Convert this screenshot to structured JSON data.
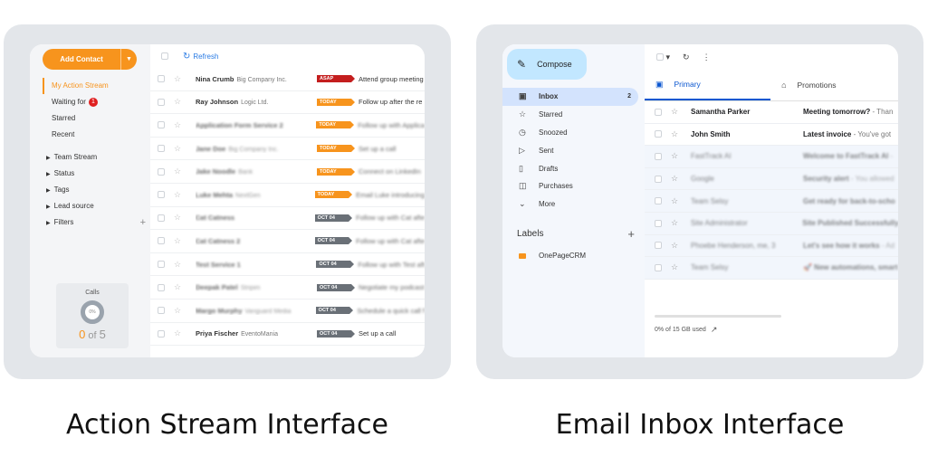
{
  "captions": {
    "left": "Action Stream Interface",
    "right": "Email Inbox Interface"
  },
  "crm": {
    "add_contact": "Add Contact",
    "refresh": "Refresh",
    "nav": [
      {
        "label": "My Action Stream",
        "active": true
      },
      {
        "label": "Waiting for",
        "badge": "1"
      },
      {
        "label": "Starred"
      },
      {
        "label": "Recent"
      }
    ],
    "groups": [
      "Team Stream",
      "Status",
      "Tags",
      "Lead source",
      "Filters"
    ],
    "calls": {
      "title": "Calls",
      "percent": "0%",
      "done": "0",
      "of": "of",
      "total": "5"
    },
    "rows": [
      {
        "name": "Nina Crumb",
        "company": "Big Company Inc.",
        "tag": "ASAP",
        "tag_type": "asap",
        "task": "Attend group meeting",
        "blur": false
      },
      {
        "name": "Ray Johnson",
        "company": "Logic Ltd.",
        "tag": "TODAY",
        "tag_type": "today",
        "task": "Follow up after the re",
        "blur": false
      },
      {
        "name": "Application Form Service 2",
        "company": "",
        "tag": "TODAY",
        "tag_type": "today",
        "task": "Follow up with Applica",
        "blur": true
      },
      {
        "name": "Jane Doe",
        "company": "Big Company Inc.",
        "tag": "TODAY",
        "tag_type": "today",
        "task": "Set up a call",
        "blur": true
      },
      {
        "name": "Jake Noodle",
        "company": "Bank",
        "tag": "TODAY",
        "tag_type": "today",
        "task": "Connect on LinkedIn",
        "blur": true
      },
      {
        "name": "Luke Mehta",
        "company": "NextGen",
        "tag": "TODAY",
        "tag_type": "today",
        "task": "Email Luke introducing",
        "blur": true
      },
      {
        "name": "Cat Catness",
        "company": "",
        "tag": "OCT 04",
        "tag_type": "oct",
        "task": "Follow up with Cat afte",
        "blur": true
      },
      {
        "name": "Cat Catness 2",
        "company": "",
        "tag": "OCT 04",
        "tag_type": "oct",
        "task": "Follow up with Cat afte",
        "blur": true
      },
      {
        "name": "Test Service 1",
        "company": "",
        "tag": "OCT 04",
        "tag_type": "oct",
        "task": "Follow up with Test aft",
        "blur": true
      },
      {
        "name": "Deepak Patel",
        "company": "Stripim",
        "tag": "OCT 04",
        "tag_type": "oct",
        "task": "Negotiate my podcast",
        "blur": true
      },
      {
        "name": "Margo Murphy",
        "company": "Vanguard Media",
        "tag": "OCT 04",
        "tag_type": "oct",
        "task": "Schedule a quick call f",
        "blur": true
      },
      {
        "name": "Priya Fischer",
        "company": "EventoMania",
        "tag": "OCT 04",
        "tag_type": "oct",
        "task": "Set up a call",
        "blur": false
      }
    ]
  },
  "mail": {
    "compose": "Compose",
    "folders": [
      {
        "label": "Inbox",
        "icon": "inbox-icon",
        "glyph": "▣",
        "count": "2",
        "active": true
      },
      {
        "label": "Starred",
        "icon": "star-icon",
        "glyph": "☆"
      },
      {
        "label": "Snoozed",
        "icon": "clock-icon",
        "glyph": "◷"
      },
      {
        "label": "Sent",
        "icon": "send-icon",
        "glyph": "▷"
      },
      {
        "label": "Drafts",
        "icon": "draft-icon",
        "glyph": "▯"
      },
      {
        "label": "Purchases",
        "icon": "bag-icon",
        "glyph": "◫"
      },
      {
        "label": "More",
        "icon": "chevron-down-icon",
        "glyph": "⌄"
      }
    ],
    "labels_title": "Labels",
    "labels": [
      {
        "label": "OnePageCRM",
        "color": "#f7941d"
      }
    ],
    "tabs": [
      {
        "label": "Primary",
        "active": true,
        "glyph": "▣"
      },
      {
        "label": "Promotions",
        "glyph": "⌂"
      }
    ],
    "rows": [
      {
        "from": "Samantha Parker",
        "subject": "Meeting tomorrow?",
        "snippet": " - Than",
        "unread": true
      },
      {
        "from": "John Smith",
        "subject": "Latest invoice",
        "snippet": " - You've got",
        "unread": true
      },
      {
        "from": "FastTrack AI",
        "subject": "Welcome to FastTrack AI",
        "snippet": " -",
        "unread": false
      },
      {
        "from": "Google",
        "subject": "Security alert",
        "snippet": " - You allowed",
        "unread": false
      },
      {
        "from": "Team Selsy",
        "subject": "Get ready for back-to-scho",
        "snippet": "",
        "unread": false
      },
      {
        "from": "Site Administrator",
        "subject": "Site Published Successfully",
        "snippet": "",
        "unread": false
      },
      {
        "from": "Phoebe Henderson, me, 3",
        "subject": "Let's see how it works",
        "snippet": " - Ad",
        "unread": false
      },
      {
        "from": "Team Selsy",
        "subject": "🚀 New automations, smart",
        "snippet": "",
        "unread": false
      }
    ],
    "storage": {
      "text": "0% of 15 GB used",
      "fraction": 0
    }
  }
}
